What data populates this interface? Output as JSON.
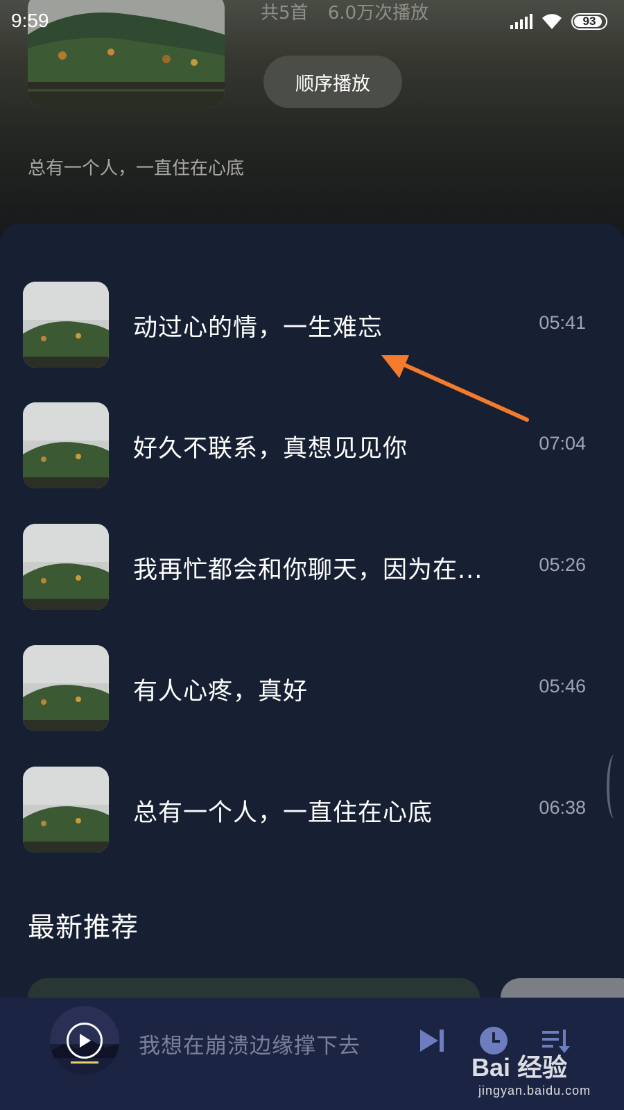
{
  "status_bar": {
    "time": "9:59",
    "battery": "93"
  },
  "album": {
    "song_count": "共5首",
    "play_count": "6.0万次播放",
    "play_order_label": "顺序播放",
    "description": "总有一个人，一直住在心底"
  },
  "songs": [
    {
      "title": "动过心的情，一生难忘",
      "duration": "05:41"
    },
    {
      "title": "好久不联系，真想见见你",
      "duration": "07:04"
    },
    {
      "title": "我再忙都会和你聊天，因为在...",
      "duration": "05:26"
    },
    {
      "title": "有人心疼，真好",
      "duration": "05:46"
    },
    {
      "title": "总有一个人，一直住在心底",
      "duration": "06:38"
    }
  ],
  "section": {
    "recommend_title": "最新推荐"
  },
  "player": {
    "now_playing": "我想在崩溃边缘撑下去"
  },
  "watermark": {
    "logo": "Bai 经验",
    "url": "jingyan.baidu.com"
  },
  "colors": {
    "arrow": "#f47a2c",
    "panel_bg": "#171f33",
    "player_bg": "#1b2442",
    "control_icon": "#6e7cc0"
  },
  "icons": [
    "wifi-icon",
    "signal-icon",
    "battery-icon",
    "play-icon",
    "skip-next-icon",
    "timer-icon",
    "playlist-icon"
  ]
}
